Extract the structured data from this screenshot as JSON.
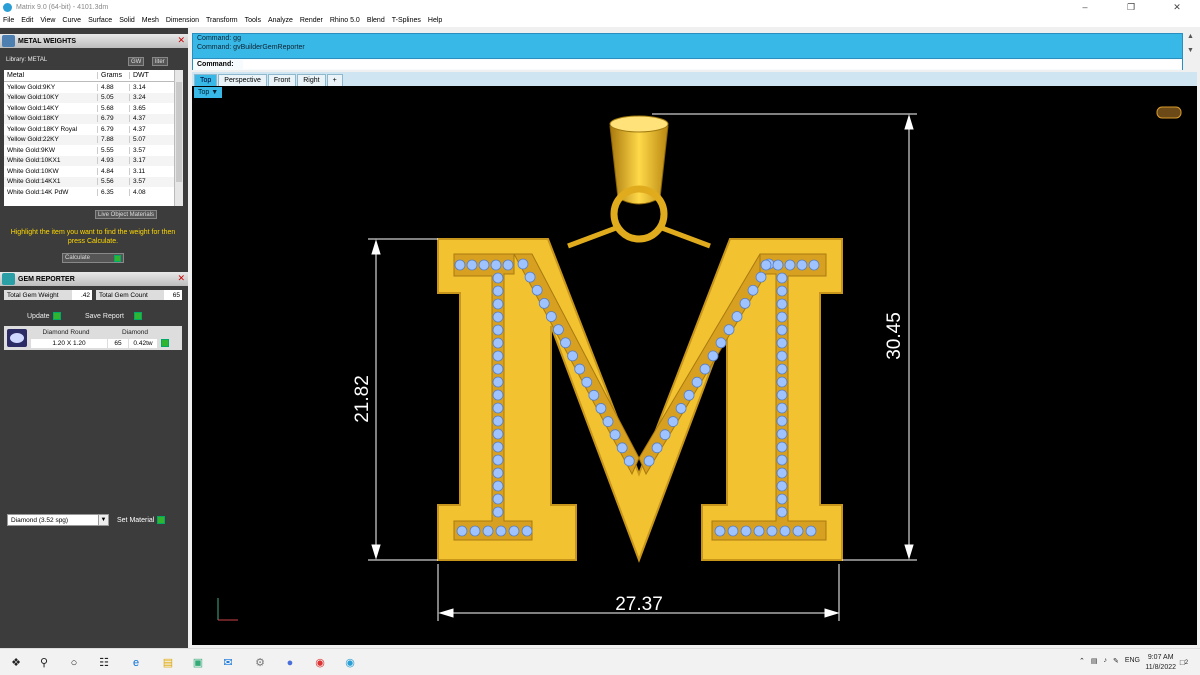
{
  "window": {
    "title": "Matrix 9.0 (64-bit) - 4101.3dm"
  },
  "menu": [
    "File",
    "Edit",
    "View",
    "Curve",
    "Surface",
    "Solid",
    "Mesh",
    "Dimension",
    "Transform",
    "Tools",
    "Analyze",
    "Render",
    "Rhino 5.0",
    "Blend",
    "T-Splines",
    "Help"
  ],
  "metal_weights": {
    "title": "METAL WEIGHTS",
    "library_label": "Library: METAL",
    "btn_gw": "GW",
    "btn_liter": "liter",
    "columns": [
      "Metal",
      "Grams",
      "DWT"
    ],
    "rows": [
      [
        "Yellow Gold:9KY",
        "4.88",
        "3.14"
      ],
      [
        "Yellow Gold:10KY",
        "5.05",
        "3.24"
      ],
      [
        "Yellow Gold:14KY",
        "5.68",
        "3.65"
      ],
      [
        "Yellow Gold:18KY",
        "6.79",
        "4.37"
      ],
      [
        "Yellow Gold:18KY Royal",
        "6.79",
        "4.37"
      ],
      [
        "Yellow Gold:22KY",
        "7.88",
        "5.07"
      ],
      [
        "White Gold:9KW",
        "5.55",
        "3.57"
      ],
      [
        "White Gold:10KX1",
        "4.93",
        "3.17"
      ],
      [
        "White Gold:10KW",
        "4.84",
        "3.11"
      ],
      [
        "White Gold:14KX1",
        "5.56",
        "3.57"
      ],
      [
        "White Gold:14K PdW",
        "6.35",
        "4.08"
      ]
    ],
    "live_object": "Live Object Materials",
    "hint": "Highlight the item you want to find the weight for then press Calculate.",
    "calculate": "Calculate"
  },
  "gem_reporter": {
    "title": "GEM REPORTER",
    "total_weight_label": "Total Gem Weight",
    "total_weight": ".42",
    "total_count_label": "Total Gem Count",
    "total_count": "65",
    "update": "Update",
    "save_report": "Save Report",
    "gem": {
      "shape": "Diamond Round",
      "size": "1.20 X 1.20",
      "material": "Diamond",
      "count": "65",
      "weight": "0.42tw"
    }
  },
  "material": {
    "dropdown": "Diamond    (3.52 spg)",
    "set_material": "Set Material"
  },
  "command": {
    "history": [
      "Command: gg",
      "Command: gvBuilderGemReporter"
    ],
    "prompt": "Command:"
  },
  "tabs": [
    "Top",
    "Perspective",
    "Front",
    "Right",
    "+"
  ],
  "viewport_label": "Top",
  "dimensions": {
    "left": "21.82",
    "right": "30.45",
    "bottom": "27.37"
  },
  "colors": {
    "gold": "#f2c230",
    "gold_dark": "#b88a10",
    "gem": "#9fc3ff",
    "accent": "#37b8e6"
  },
  "taskbar": {
    "lang": "ENG",
    "time": "9:07 AM",
    "date": "11/8/2022",
    "notif": "2"
  }
}
